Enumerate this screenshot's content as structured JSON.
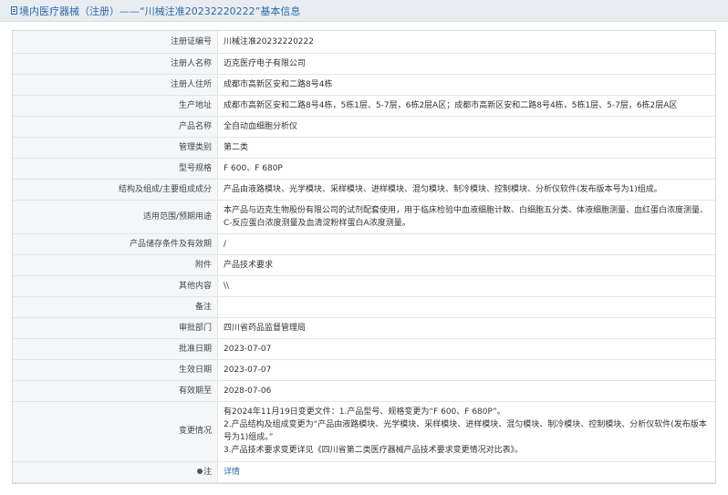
{
  "header": {
    "title": "境内医疗器械（注册）——“川械注准20232220222”基本信息"
  },
  "fields": {
    "reg_no": {
      "label": "注册证编号",
      "value": "川械注准20232220222"
    },
    "registrant": {
      "label": "注册人名称",
      "value": "迈克医疗电子有限公司"
    },
    "reg_address": {
      "label": "注册人住所",
      "value": "成都市高新区安和二路8号4栋"
    },
    "prod_address": {
      "label": "生产地址",
      "value": "成都市高新区安和二路8号4栋，5栋1层、5-7层，6栋2层A区；成都市高新区安和二路8号4栋，5栋1层、5-7层，6栋2层A区"
    },
    "product_name": {
      "label": "产品名称",
      "value": "全自动血细胞分析仪"
    },
    "category": {
      "label": "管理类别",
      "value": "第二类"
    },
    "model": {
      "label": "型号规格",
      "value": "F 600、F 680P"
    },
    "structure": {
      "label": "结构及组成/主要组成成分",
      "value": "产品由液路模块、光学模块、采样模块、进样模块、混匀模块、制冷模块、控制模块、分析仪软件(发布版本号为1)组成。"
    },
    "usage": {
      "label": "适用范围/预期用途",
      "value": "本产品与迈克生物股份有限公司的试剂配套使用，用于临床检验中血液细胞计数、白细胞五分类、体液细胞测量、血红蛋白浓度测量、C-反应蛋白浓度测量及血清淀粉样蛋白A浓度测量。"
    },
    "storage": {
      "label": "产品储存条件及有效期",
      "value": "/"
    },
    "attachment": {
      "label": "附件",
      "value": "产品技术要求"
    },
    "other": {
      "label": "其他内容",
      "value": "\\\\"
    },
    "remark": {
      "label": "备注",
      "value": ""
    },
    "approval_dept": {
      "label": "审批部门",
      "value": "四川省药品监督管理局"
    },
    "approval_date": {
      "label": "批准日期",
      "value": "2023-07-07"
    },
    "effective_date": {
      "label": "生效日期",
      "value": "2023-07-07"
    },
    "expiry_date": {
      "label": "有效期至",
      "value": "2028-07-06"
    },
    "changes": {
      "label": "变更情况",
      "line1": "有2024年11月19日变更文件：1.产品型号、规格变更为“F 600、F 680P”。",
      "line2": "2.产品结构及组成变更为“产品由液路模块、光学模块、采样模块、进样模块、混匀模块、制冷模块、控制模块、分析仪软件(发布版本号为1)组成。”",
      "line3": "3.产品技术要求变更详见《四川省第二类医疗器械产品技术要求变更情况对比表》。"
    },
    "note": {
      "label": "注",
      "value": "详情"
    }
  },
  "icons": {
    "title_icon": "document-icon",
    "note_icon": "pin-icon"
  },
  "colors": {
    "accent": "#2b6aa8",
    "label_bg": "#f5f6f8",
    "header_bg": "#e9edf2"
  }
}
